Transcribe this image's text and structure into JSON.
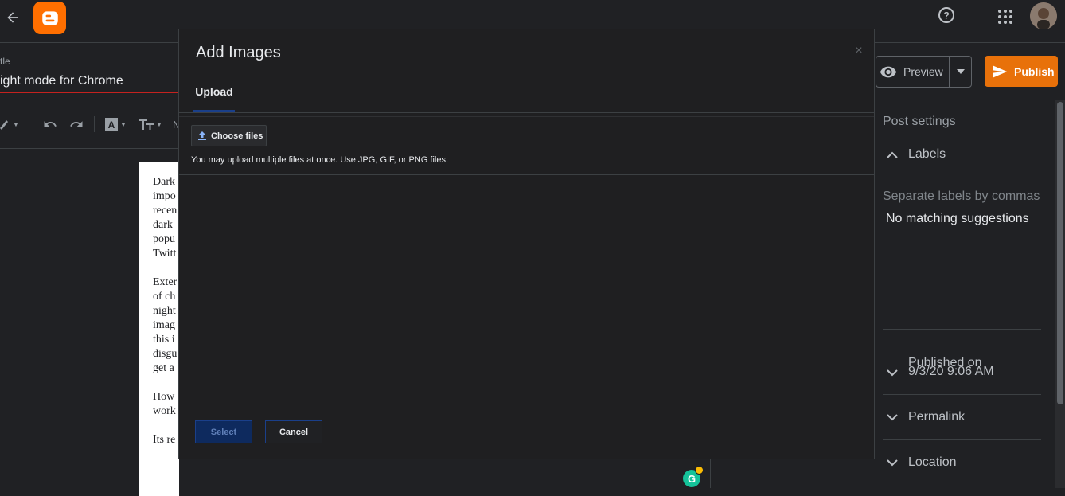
{
  "topbar": {
    "back_icon": "arrow-back-icon",
    "logo_icon": "blogger-logo-icon",
    "help_icon": "help-circle-icon",
    "apps_icon": "apps-grid-icon",
    "avatar": "user-avatar"
  },
  "editor": {
    "title_label": "tle",
    "title_value": "ight mode for Chrome",
    "toolbar": {
      "pencil_icon": "pencil-icon",
      "undo_icon": "undo-icon",
      "redo_icon": "redo-icon",
      "text_color_icon": "text-color-icon",
      "font_size_icon": "font-size-icon",
      "normal_label": "N"
    },
    "paragraphs": [
      [
        "Dark",
        "impo",
        "recen",
        "dark",
        "popu",
        "Twitt"
      ],
      [
        "Exter",
        "of ch",
        "night",
        "imag",
        "this i",
        "disgu",
        "get a"
      ],
      [
        "How",
        "work"
      ],
      [
        "Its re"
      ]
    ]
  },
  "actions": {
    "preview_label": "Preview",
    "publish_label": "Publish",
    "publish_color": "#e8710a"
  },
  "settings": {
    "heading": "Post settings",
    "labels_title": "Labels",
    "labels_placeholder": "Separate labels by commas",
    "no_suggestions": "No matching suggestions",
    "published_on_title": "Published on",
    "published_on_value": "9/3/20 9:06 AM",
    "permalink_title": "Permalink",
    "location_title": "Location"
  },
  "modal": {
    "title": "Add Images",
    "close_symbol": "×",
    "tab_upload": "Upload",
    "choose_files_label": "Choose files",
    "hint": "You may upload multiple files at once. Use JPG, GIF, or PNG files.",
    "select_label": "Select",
    "cancel_label": "Cancel"
  },
  "grammarly": {
    "letter": "G",
    "color": "#15c39a"
  }
}
